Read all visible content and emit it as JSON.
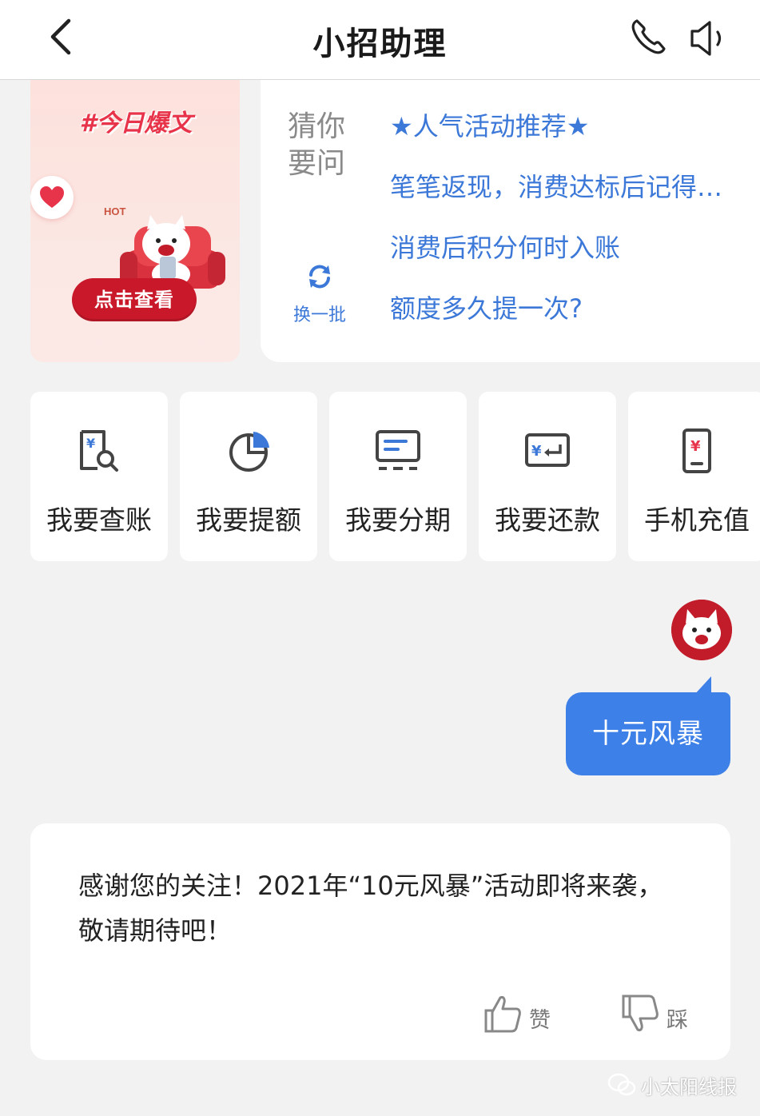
{
  "header": {
    "title": "小招助理",
    "icons": {
      "back": "chevron-left-icon",
      "phone": "phone-icon",
      "speaker": "speaker-icon"
    }
  },
  "banner": {
    "tag": "#今日爆文",
    "hot_label": "HOT",
    "button_label": "点击查看",
    "accent_color": "#c8182a"
  },
  "guess": {
    "label": "猜你要问",
    "refresh_label": "换一批",
    "questions": [
      "★人气活动推荐★",
      "笔笔返现，消费达标后记得…",
      "消费后积分何时入账",
      "额度多久提一次?"
    ],
    "link_color": "#3c78d8"
  },
  "shortcuts": [
    {
      "label": "我要查账",
      "icon": "bill-search-icon"
    },
    {
      "label": "我要提额",
      "icon": "pie-chart-icon"
    },
    {
      "label": "我要分期",
      "icon": "installment-icon"
    },
    {
      "label": "我要还款",
      "icon": "repay-card-icon"
    },
    {
      "label": "手机充值",
      "icon": "phone-recharge-icon"
    }
  ],
  "chat": {
    "user_message": "十元风暴",
    "user_bubble_color": "#3d80e8",
    "reply_text": "感谢您的关注！2021年“10元风暴”活动即将来袭，敬请期待吧！",
    "like_label": "赞",
    "dislike_label": "踩"
  },
  "watermark": {
    "text": "小太阳线报"
  }
}
